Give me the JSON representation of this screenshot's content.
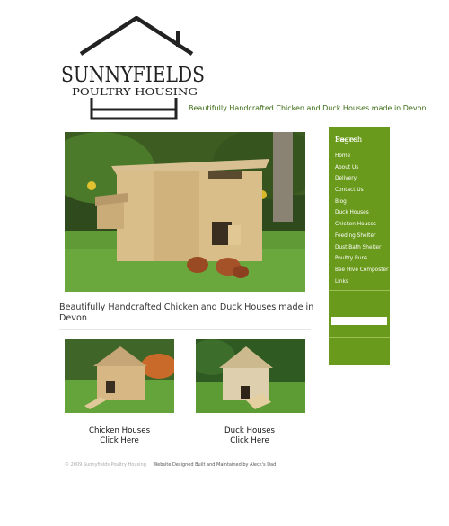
{
  "header": {
    "logo_line1": "SUNNYFIELDS",
    "logo_line2": "POULTRY HOUSING",
    "tagline": "Beautifully Handcrafted Chicken and Duck Houses made in Devon"
  },
  "sidebar": {
    "pages_title": "Pages",
    "items": [
      {
        "label": "Home"
      },
      {
        "label": "About Us"
      },
      {
        "label": "Delivery"
      },
      {
        "label": "Contact Us"
      },
      {
        "label": "Blog"
      },
      {
        "label": "Duck Houses"
      },
      {
        "label": "Chicken Houses"
      },
      {
        "label": "Feeding Shelter"
      },
      {
        "label": "Dust Bath Shelter"
      },
      {
        "label": "Poultry Runs"
      },
      {
        "label": "Bee Hive Composter"
      },
      {
        "label": "Links"
      }
    ],
    "search_title": "Search",
    "search_value": ""
  },
  "main": {
    "headline": "Beautifully Handcrafted Chicken and Duck Houses made in Devon",
    "products": [
      {
        "line1": "Chicken Houses",
        "line2": "Click Here"
      },
      {
        "line1": "Duck Houses",
        "line2": "Click Here"
      }
    ]
  },
  "footer": {
    "copyright": "© 2009 Sunnyfields Poultry Housing",
    "credit": "Website Designed Built and Maintained by Aleck's Dad"
  },
  "colors": {
    "sidebar_bg": "#6a9a1c",
    "tagline": "#3a6a12",
    "logo": "#222222"
  }
}
